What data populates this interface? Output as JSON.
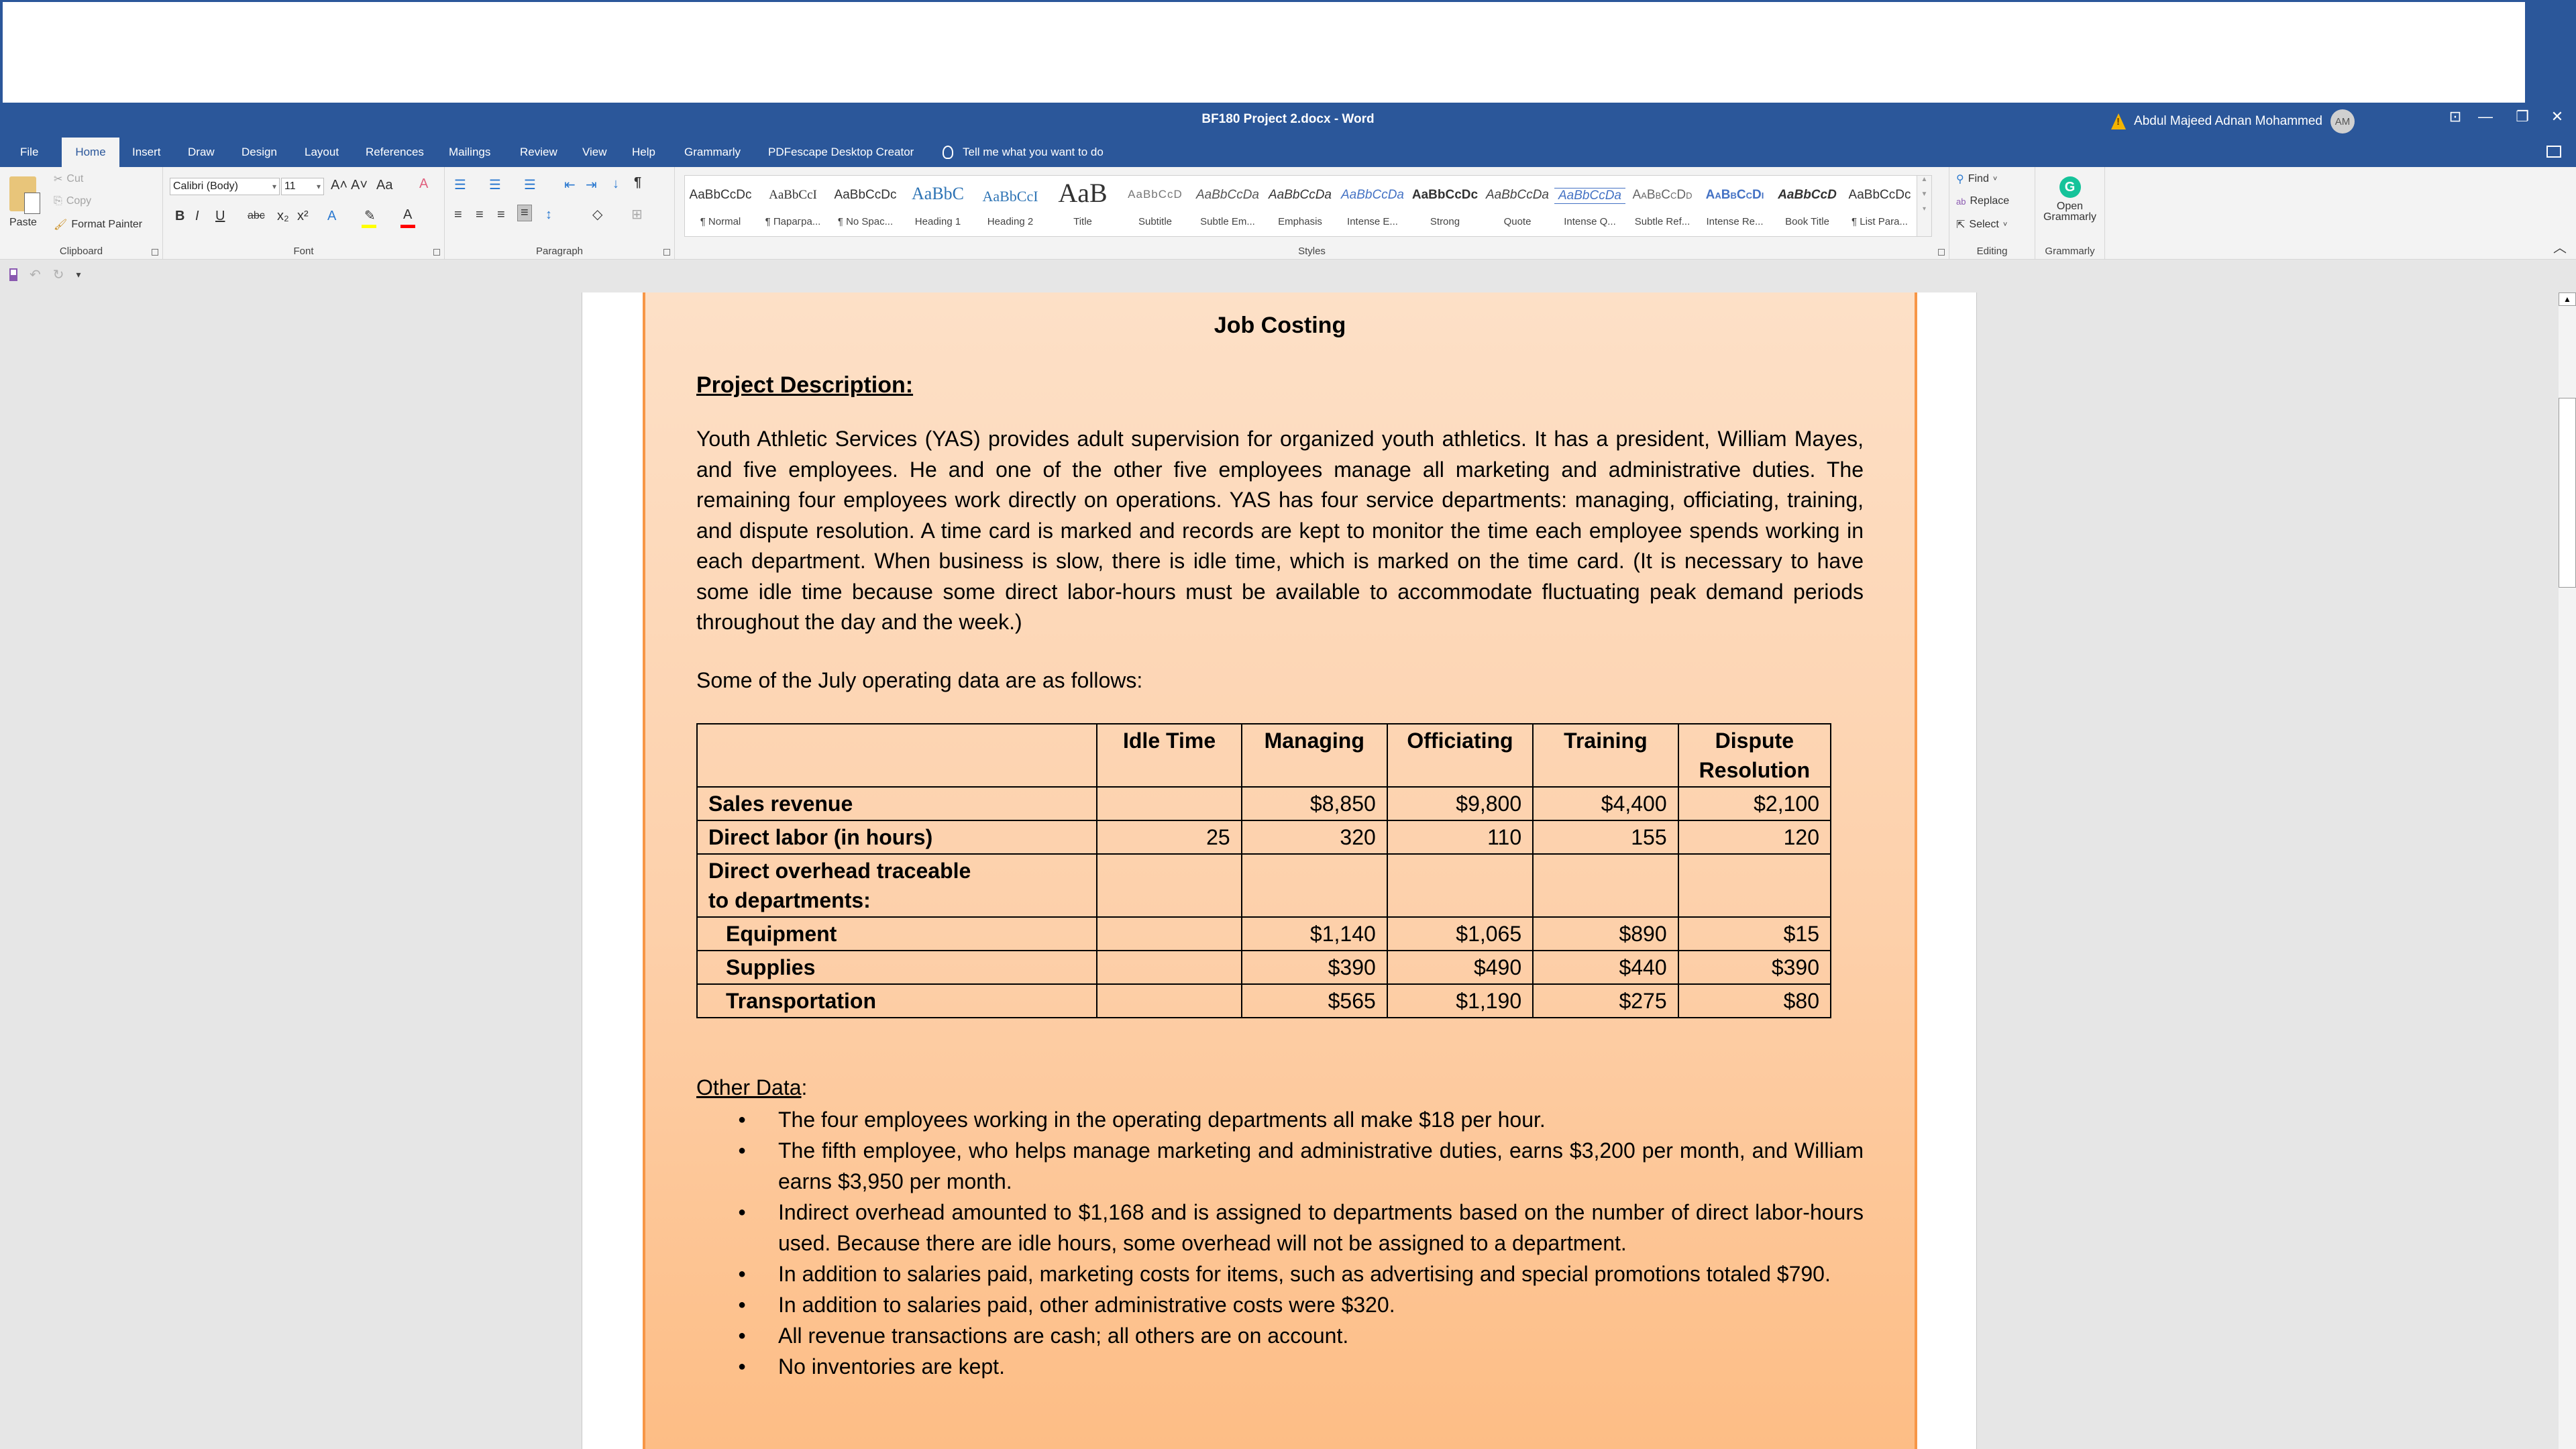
{
  "window": {
    "doc_title": "BF180 Project 2.docx  -  Word",
    "user_name": "Abdul Majeed Adnan Mohammed",
    "user_initials": "AM",
    "controls": {
      "ribbon_display": "⊡",
      "minimize": "—",
      "restore": "❐",
      "close": "✕"
    }
  },
  "tabs": [
    {
      "label": "File"
    },
    {
      "label": "Home",
      "active": true
    },
    {
      "label": "Insert"
    },
    {
      "label": "Draw"
    },
    {
      "label": "Design"
    },
    {
      "label": "Layout"
    },
    {
      "label": "References"
    },
    {
      "label": "Mailings"
    },
    {
      "label": "Review"
    },
    {
      "label": "View"
    },
    {
      "label": "Help"
    },
    {
      "label": "Grammarly"
    },
    {
      "label": "PDFescape Desktop Creator"
    }
  ],
  "tell_me": "Tell me what you want to do",
  "ribbon": {
    "clipboard": {
      "label": "Clipboard",
      "paste": "Paste",
      "cut": "Cut",
      "copy": "Copy",
      "format_painter": "Format Painter"
    },
    "font": {
      "label": "Font",
      "font_name": "Calibri (Body)",
      "font_size": "11",
      "grow": "A˄",
      "shrink": "A˅",
      "change_case": "Aa",
      "bold": "B",
      "italic": "I",
      "underline": "U",
      "strike": "abc",
      "subscript": "x₂",
      "superscript": "x²",
      "highlight_color": "#ffff00",
      "font_color": "#ff0000"
    },
    "paragraph": {
      "label": "Paragraph",
      "pilcrow": "¶"
    },
    "styles": {
      "label": "Styles",
      "items": [
        {
          "sample": "AaBbCcDc",
          "name": "¶ Normal"
        },
        {
          "sample": "AaBbCcI",
          "name": "¶ Парагра..."
        },
        {
          "sample": "AaBbCcDc",
          "name": "¶ No Spac..."
        },
        {
          "sample": "AaBbC",
          "name": "Heading 1"
        },
        {
          "sample": "AaBbCcI",
          "name": "Heading 2"
        },
        {
          "sample": "AaB",
          "name": "Title"
        },
        {
          "sample": "AaBbCcD",
          "name": "Subtitle"
        },
        {
          "sample": "AaBbCcDa",
          "name": "Subtle Em..."
        },
        {
          "sample": "AaBbCcDa",
          "name": "Emphasis"
        },
        {
          "sample": "AaBbCcDa",
          "name": "Intense E..."
        },
        {
          "sample": "AaBbCcDc",
          "name": "Strong"
        },
        {
          "sample": "AaBbCcDa",
          "name": "Quote"
        },
        {
          "sample": "AaBbCcDa",
          "name": "Intense Q..."
        },
        {
          "sample": "AaBbCcDd",
          "name": "Subtle Ref..."
        },
        {
          "sample": "AaBbCcDi",
          "name": "Intense Re..."
        },
        {
          "sample": "AaBbCcD",
          "name": "Book Title"
        },
        {
          "sample": "AaBbCcDc",
          "name": "¶ List Para..."
        }
      ]
    },
    "editing": {
      "label": "Editing",
      "find": "Find",
      "replace": "Replace",
      "select": "Select"
    },
    "grammarly": {
      "label": "Grammarly",
      "open_line1": "Open",
      "open_line2": "Grammarly"
    }
  },
  "document": {
    "title": "Job Costing",
    "project_heading": "Project Description:",
    "description": "Youth Athletic Services (YAS) provides adult supervision for organized youth athletics. It has a president, William Mayes, and five employees. He and one of the other five employees manage all marketing and administrative duties. The remaining four employees work directly on operations. YAS has four service departments: managing, officiating, training, and dispute resolution. A time card is marked and records are kept to monitor the time each employee spends working in each department. When business is slow, there is idle time, which is marked on the time card. (It is necessary to have some idle time because some direct labor-hours must be available to accommodate fluctuating peak demand periods throughout the day and the week.)",
    "intro": "Some of the July operating data are as follows:",
    "table": {
      "headers": [
        "",
        "Idle Time",
        "Managing",
        "Officiating",
        "Training",
        "Dispute Resolution"
      ],
      "rows": [
        {
          "label": "Sales revenue",
          "indent": false,
          "values": [
            "",
            "$8,850",
            "$9,800",
            "$4,400",
            "$2,100"
          ]
        },
        {
          "label": "Direct labor (in hours)",
          "indent": false,
          "values": [
            "25",
            "320",
            "110",
            "155",
            "120"
          ]
        },
        {
          "label": "Direct overhead traceable to departments:",
          "indent": false,
          "values": [
            "",
            "",
            "",
            "",
            ""
          ]
        },
        {
          "label": "Equipment",
          "indent": true,
          "values": [
            "",
            "$1,140",
            "$1,065",
            "$890",
            "$15"
          ]
        },
        {
          "label": "Supplies",
          "indent": true,
          "values": [
            "",
            "$390",
            "$490",
            "$440",
            "$390"
          ]
        },
        {
          "label": "Transportation",
          "indent": true,
          "values": [
            "",
            "$565",
            "$1,190",
            "$275",
            "$80"
          ]
        }
      ]
    },
    "other_heading": "Other Data",
    "other_colon": ":",
    "other_items": [
      "The four employees working in the operating departments all make $18 per hour.",
      "The fifth employee, who helps manage marketing and administrative duties, earns $3,200 per month, and William earns $3,950 per month.",
      "Indirect overhead amounted to $1,168 and is assigned to departments based on the number of direct labor-hours used. Because there are idle hours, some overhead will not be assigned to a department.",
      "In addition to salaries paid, marketing costs for items, such as advertising and special promotions totaled $790.",
      "In addition to salaries paid, other administrative costs were $320.",
      "All revenue transactions are cash; all others are on account.",
      "No inventories are kept."
    ]
  },
  "colors": {
    "accent": "#2b579a",
    "page_border": "#f79646",
    "grammarly": "#15c39a"
  }
}
